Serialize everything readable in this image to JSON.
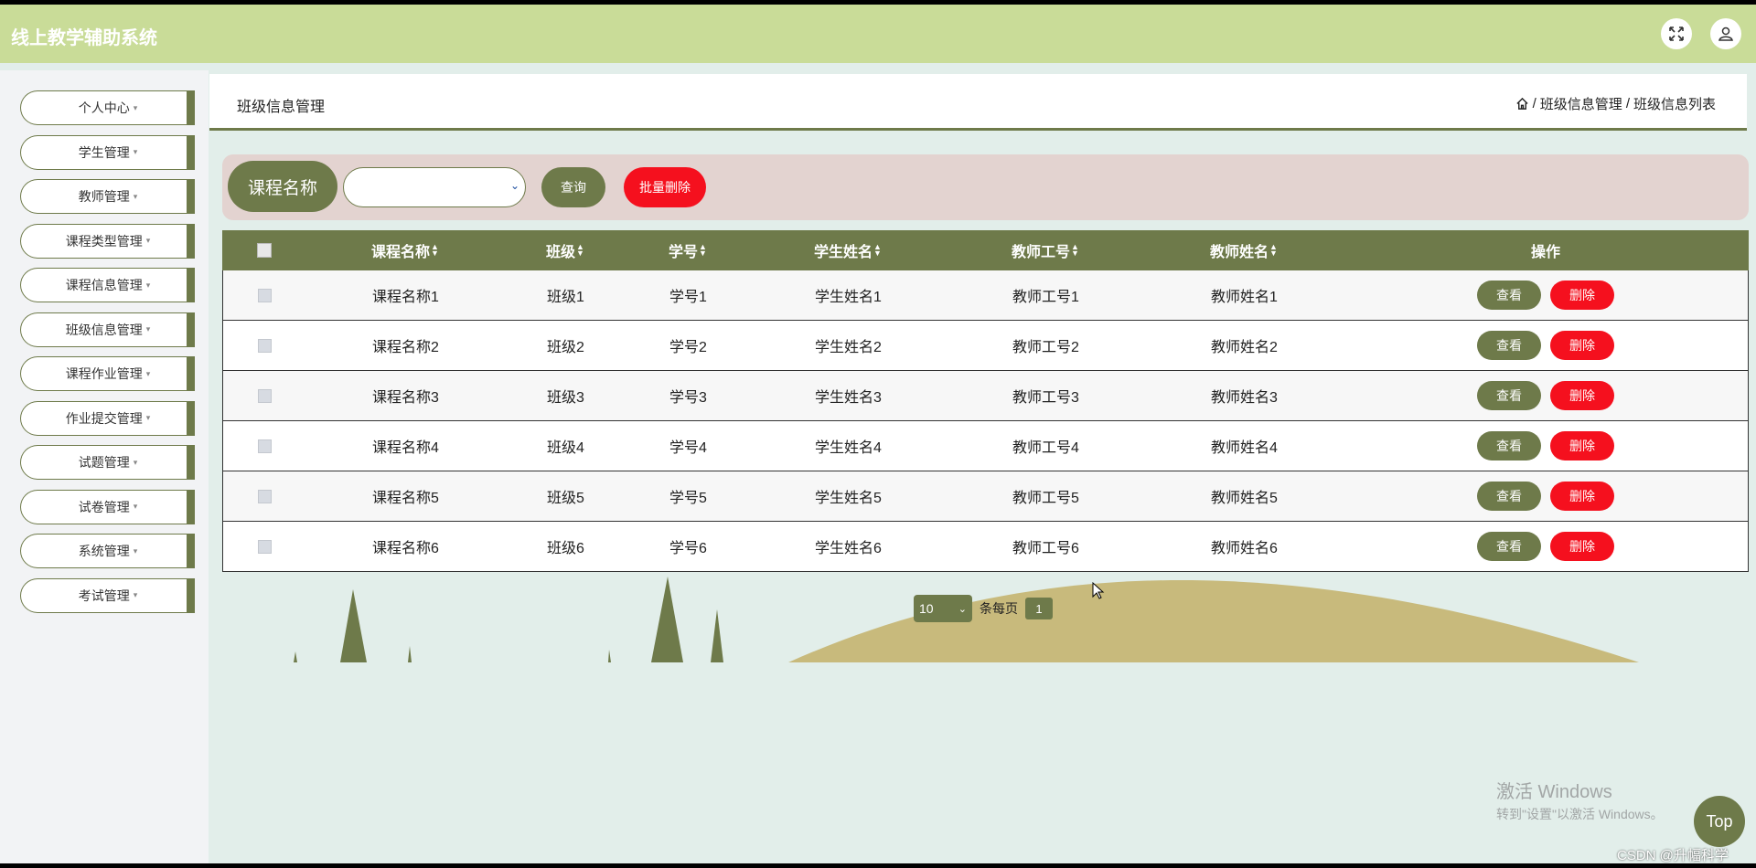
{
  "app": {
    "title": "线上教学辅助系统"
  },
  "header": {
    "fullscreen_icon": "expand-icon",
    "user_icon": "user-icon"
  },
  "sidebar": {
    "items": [
      {
        "label": "个人中心"
      },
      {
        "label": "学生管理"
      },
      {
        "label": "教师管理"
      },
      {
        "label": "课程类型管理"
      },
      {
        "label": "课程信息管理"
      },
      {
        "label": "班级信息管理"
      },
      {
        "label": "课程作业管理"
      },
      {
        "label": "作业提交管理"
      },
      {
        "label": "试题管理"
      },
      {
        "label": "试卷管理"
      },
      {
        "label": "系统管理"
      },
      {
        "label": "考试管理"
      }
    ]
  },
  "page": {
    "title": "班级信息管理",
    "breadcrumb": [
      "班级信息管理",
      "班级信息列表"
    ],
    "breadcrumb_sep": "/"
  },
  "search": {
    "label": "课程名称",
    "select_value": "",
    "query_label": "查询",
    "batch_delete_label": "批量删除"
  },
  "table": {
    "headers": [
      "课程名称",
      "班级",
      "学号",
      "学生姓名",
      "教师工号",
      "教师姓名",
      "操作"
    ],
    "rows": [
      {
        "course": "课程名称1",
        "class": "班级1",
        "sid": "学号1",
        "sname": "学生姓名1",
        "tid": "教师工号1",
        "tname": "教师姓名1"
      },
      {
        "course": "课程名称2",
        "class": "班级2",
        "sid": "学号2",
        "sname": "学生姓名2",
        "tid": "教师工号2",
        "tname": "教师姓名2"
      },
      {
        "course": "课程名称3",
        "class": "班级3",
        "sid": "学号3",
        "sname": "学生姓名3",
        "tid": "教师工号3",
        "tname": "教师姓名3"
      },
      {
        "course": "课程名称4",
        "class": "班级4",
        "sid": "学号4",
        "sname": "学生姓名4",
        "tid": "教师工号4",
        "tname": "教师姓名4"
      },
      {
        "course": "课程名称5",
        "class": "班级5",
        "sid": "学号5",
        "sname": "学生姓名5",
        "tid": "教师工号5",
        "tname": "教师姓名5"
      },
      {
        "course": "课程名称6",
        "class": "班级6",
        "sid": "学号6",
        "sname": "学生姓名6",
        "tid": "教师工号6",
        "tname": "教师姓名6"
      }
    ],
    "view_label": "查看",
    "delete_label": "删除"
  },
  "pagination": {
    "page_size": "10",
    "per_page_label": "条每页",
    "current_page": "1"
  },
  "watermark": {
    "line1": "激活 Windows",
    "line2": "转到\"设置\"以激活 Windows。"
  },
  "top_button": "Top",
  "csdn_mark": "CSDN @升幅科学",
  "colors": {
    "primary": "#6e7a4a",
    "danger": "#f5101e",
    "header": "#c9dc98",
    "hill": "#c8ba7c"
  }
}
